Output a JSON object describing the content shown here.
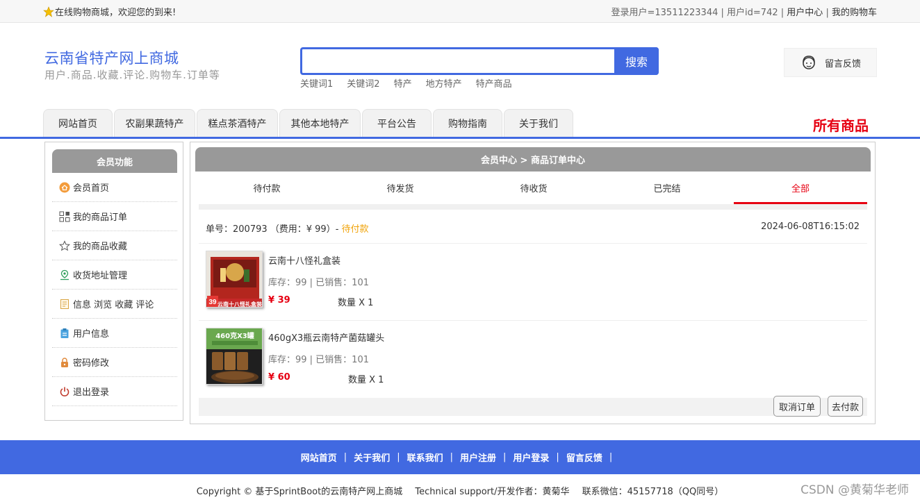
{
  "topbar": {
    "welcome": "在线购物商城，欢迎您的到来!",
    "login_user": "登录用户=13511223344",
    "user_id": "用户id=742",
    "user_center": "用户中心",
    "my_cart": "我的购物车",
    "divider": "|"
  },
  "header": {
    "title": "云南省特产网上商城",
    "subtitle": "用户.商品.收藏.评论.购物车.订单等",
    "search_value": "",
    "search_button": "搜索",
    "hotwords": [
      "关键词1",
      "关键词2",
      "特产",
      "地方特产",
      "特产商品"
    ],
    "feedback": "留言反馈"
  },
  "nav": {
    "tabs": [
      {
        "label": "网站首页",
        "width": 100
      },
      {
        "label": "农副果蔬特产",
        "width": 117
      },
      {
        "label": "糕点茶酒特产",
        "width": 117
      },
      {
        "label": "其他本地特产",
        "width": 117
      },
      {
        "label": "平台公告",
        "width": 100
      },
      {
        "label": "购物指南",
        "width": 100
      },
      {
        "label": "关于我们",
        "width": 100
      }
    ],
    "all_goods": "所有商品"
  },
  "sidebar": {
    "title": "会员功能",
    "items": [
      {
        "label": "会员首页",
        "icon": "home-icon"
      },
      {
        "label": "我的商品订单",
        "icon": "grid-icon"
      },
      {
        "label": "我的商品收藏",
        "icon": "star-outline-icon"
      },
      {
        "label": "收货地址管理",
        "icon": "location-icon"
      },
      {
        "label": "信息 浏览 收藏 评论",
        "icon": "document-icon"
      },
      {
        "label": "用户信息",
        "icon": "clipboard-icon"
      },
      {
        "label": "密码修改",
        "icon": "lock-icon"
      },
      {
        "label": "退出登录",
        "icon": "power-icon"
      }
    ]
  },
  "main": {
    "breadcrumb": "会员中心 > 商品订单中心",
    "status_tabs": [
      "待付款",
      "待发货",
      "待收货",
      "已完结",
      "全部"
    ],
    "active_tab": 4,
    "order": {
      "number_text": "单号：200793 （费用：¥ 99）-",
      "status": "待付款",
      "time": "2024-06-08T16:15:02",
      "items": [
        {
          "name": "云南十八怪礼盒装",
          "stock": "库存：99 | 已销售：101",
          "price": "¥ 39",
          "qty": "数量 X 1",
          "badge": "39",
          "banner": "云南十八怪礼盒装"
        },
        {
          "name": "460gX3瓶云南特产菌菇罐头",
          "stock": "库存：99 | 已销售：101",
          "price": "¥ 60",
          "qty": "数量 X 1",
          "banner": "460克X3罐"
        }
      ],
      "cancel_button": "取消订单",
      "pay_button": "去付款"
    }
  },
  "footer": {
    "links": [
      "网站首页",
      "关于我们",
      "联系我们",
      "用户注册",
      "用户登录",
      "留言反馈"
    ],
    "divider": "|",
    "copyright": "Copyright © 基于SprintBoot的云南特产网上商城",
    "support": "Technical support/开发作者：黄菊华",
    "contact": "联系微信：45157718（QQ同号）",
    "watermark": "CSDN @黄菊华老师"
  },
  "colors": {
    "brand": "#4169e1",
    "accent_red": "#e60012",
    "pending_orange": "#f0a30a",
    "header_gray": "#999999"
  }
}
